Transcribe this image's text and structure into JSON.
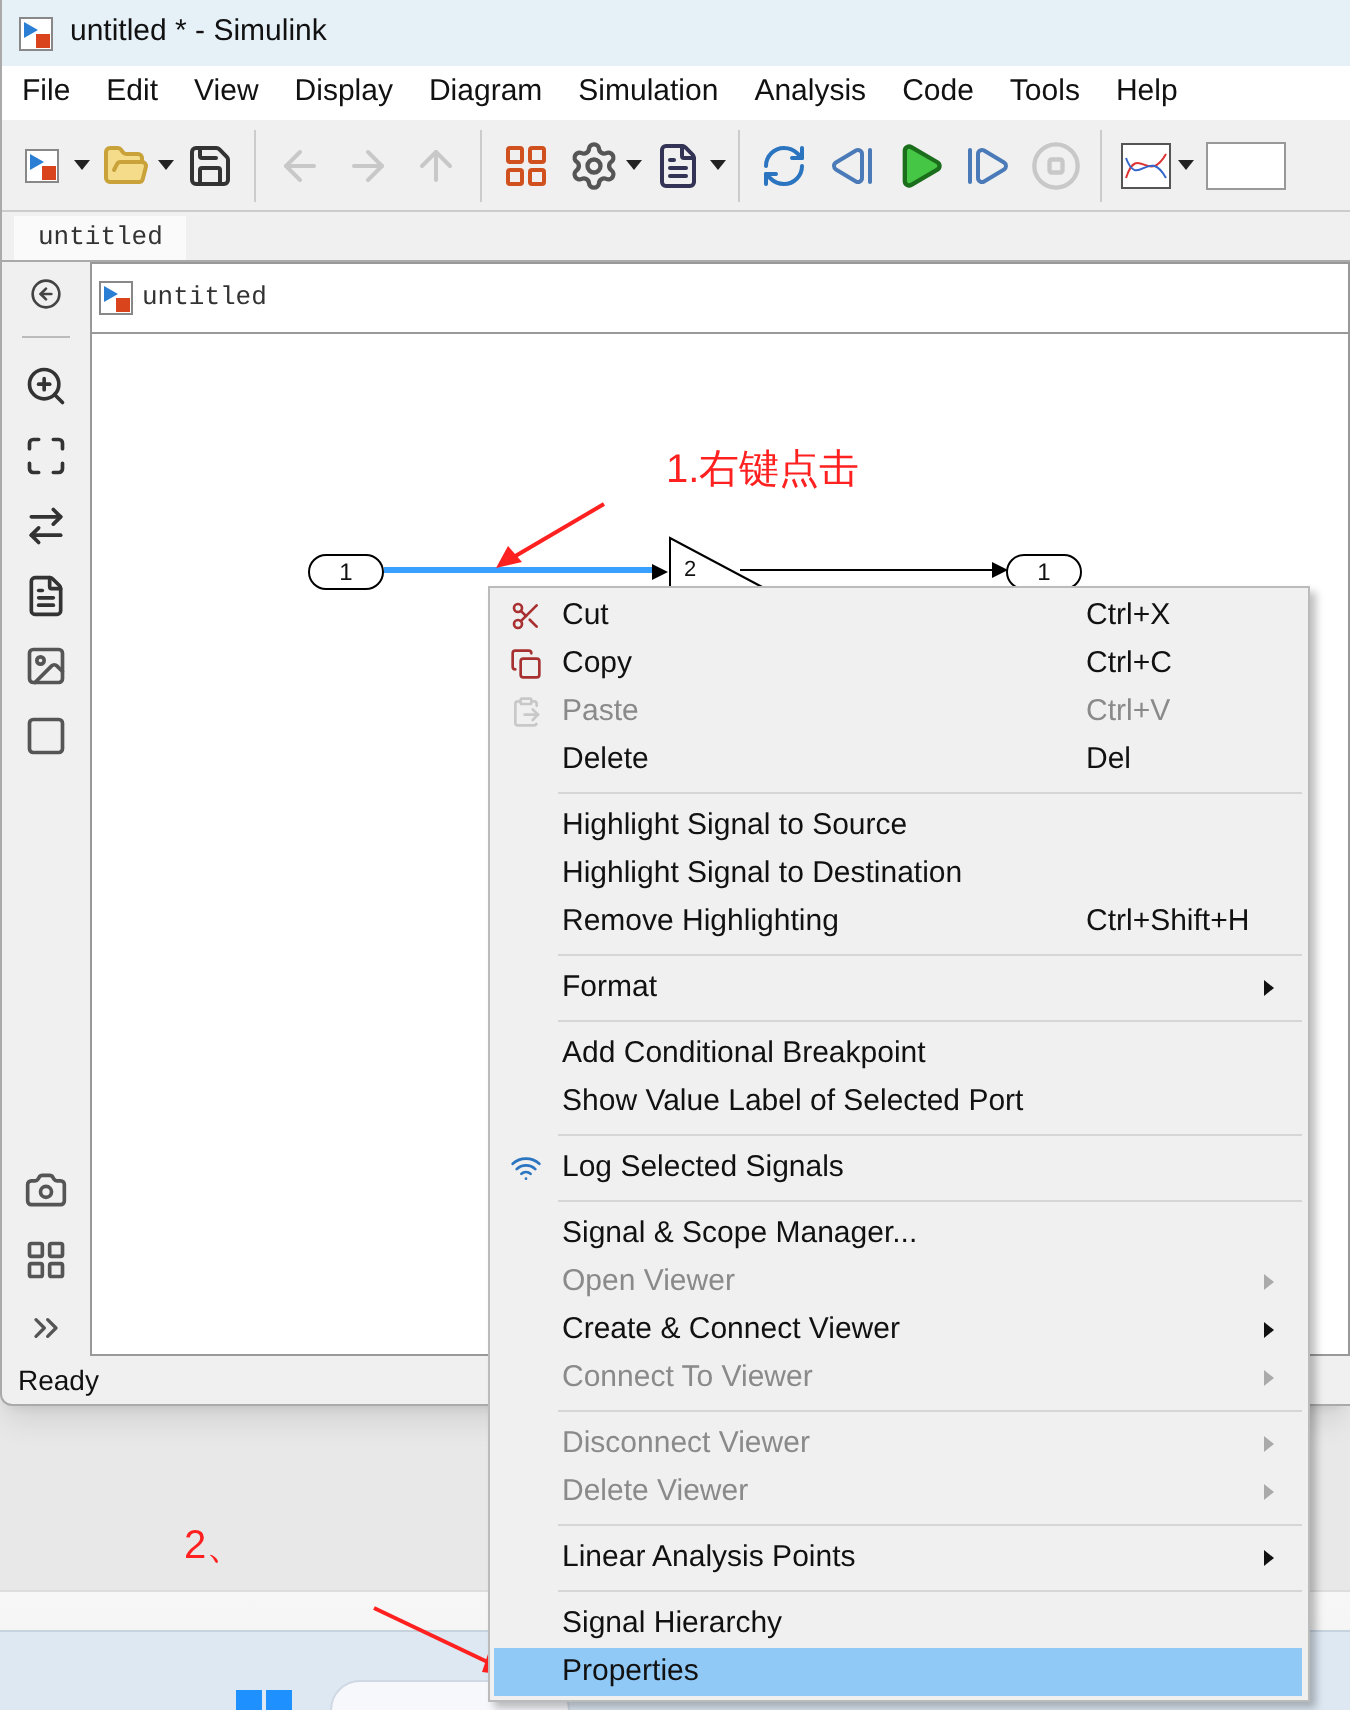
{
  "window": {
    "title": "untitled * - Simulink"
  },
  "menu_bar": [
    "File",
    "Edit",
    "View",
    "Display",
    "Diagram",
    "Simulation",
    "Analysis",
    "Code",
    "Tools",
    "Help"
  ],
  "tabs": [
    {
      "label": "untitled",
      "selected": true
    }
  ],
  "breadcrumb": {
    "label": "untitled"
  },
  "diagram": {
    "inport": "1",
    "gain": "2",
    "outport": "1",
    "signal_selected": true
  },
  "annotations": [
    "1.右键点击",
    "2、"
  ],
  "status_bar": "Ready",
  "context_menu": {
    "groups": [
      [
        {
          "label": "Cut",
          "shortcut": "Ctrl+X",
          "disabled": false,
          "submenu": false,
          "selected": false
        },
        {
          "label": "Copy",
          "shortcut": "Ctrl+C",
          "disabled": false,
          "submenu": false,
          "selected": false
        },
        {
          "label": "Paste",
          "shortcut": "Ctrl+V",
          "disabled": true,
          "submenu": false,
          "selected": false
        },
        {
          "label": "Delete",
          "shortcut": "Del",
          "disabled": false,
          "submenu": false,
          "selected": false
        }
      ],
      [
        {
          "label": "Highlight Signal to Source",
          "disabled": false,
          "submenu": false,
          "selected": false
        },
        {
          "label": "Highlight Signal to Destination",
          "disabled": false,
          "submenu": false,
          "selected": false
        },
        {
          "label": "Remove Highlighting",
          "shortcut": "Ctrl+Shift+H",
          "disabled": false,
          "submenu": false,
          "selected": false
        }
      ],
      [
        {
          "label": "Format",
          "disabled": false,
          "submenu": true,
          "selected": false
        }
      ],
      [
        {
          "label": "Add Conditional Breakpoint",
          "disabled": false,
          "submenu": false,
          "selected": false
        },
        {
          "label": "Show Value Label of Selected Port",
          "disabled": false,
          "submenu": false,
          "selected": false
        }
      ],
      [
        {
          "label": "Log Selected Signals",
          "disabled": false,
          "submenu": false,
          "selected": false
        }
      ],
      [
        {
          "label": "Signal & Scope Manager...",
          "disabled": false,
          "submenu": false,
          "selected": false
        },
        {
          "label": "Open Viewer",
          "disabled": true,
          "submenu": true,
          "selected": false
        },
        {
          "label": "Create & Connect Viewer",
          "disabled": false,
          "submenu": true,
          "selected": false
        },
        {
          "label": "Connect To Viewer",
          "disabled": true,
          "submenu": true,
          "selected": false
        }
      ],
      [
        {
          "label": "Disconnect Viewer",
          "disabled": true,
          "submenu": true,
          "selected": false
        },
        {
          "label": "Delete Viewer",
          "disabled": true,
          "submenu": true,
          "selected": false
        }
      ],
      [
        {
          "label": "Linear Analysis Points",
          "disabled": false,
          "submenu": true,
          "selected": false
        }
      ],
      [
        {
          "label": "Signal Hierarchy",
          "disabled": false,
          "submenu": false,
          "selected": false
        },
        {
          "label": "Properties",
          "disabled": false,
          "submenu": false,
          "selected": true
        }
      ]
    ]
  }
}
